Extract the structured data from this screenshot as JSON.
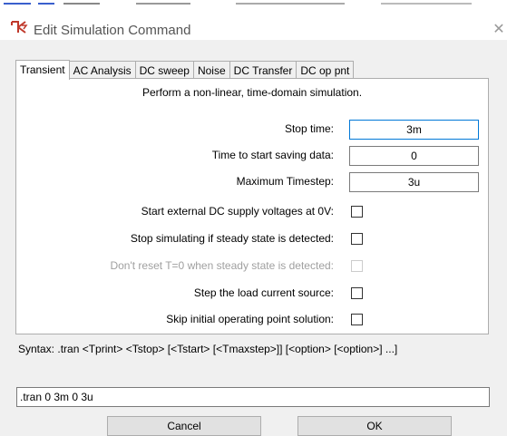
{
  "window": {
    "title": "Edit Simulation Command",
    "close_glyph": "✕"
  },
  "tabs": [
    "Transient",
    "AC Analysis",
    "DC sweep",
    "Noise",
    "DC Transfer",
    "DC op pnt"
  ],
  "transient": {
    "description": "Perform a non-linear, time-domain simulation.",
    "stop_time_label": "Stop time:",
    "stop_time_value": "3m",
    "start_saving_label": "Time to start saving data:",
    "start_saving_value": "0",
    "max_timestep_label": "Maximum Timestep:",
    "max_timestep_value": "3u",
    "checkboxes": [
      {
        "label": "Start external DC supply voltages at 0V:",
        "checked": false,
        "disabled": false
      },
      {
        "label": "Stop simulating if steady state is detected:",
        "checked": false,
        "disabled": false
      },
      {
        "label": "Don't reset T=0 when steady state is detected:",
        "checked": false,
        "disabled": true
      },
      {
        "label": "Step the load current source:",
        "checked": false,
        "disabled": false
      },
      {
        "label": "Skip initial operating point solution:",
        "checked": false,
        "disabled": false
      }
    ]
  },
  "syntax": "Syntax:  .tran <Tprint> <Tstop> [<Tstart> [<Tmaxstep>]] [<option> [<option>] ...]",
  "command_text": ".tran 0 3m 0 3u",
  "buttons": {
    "cancel": "Cancel",
    "ok": "OK"
  },
  "colors": {
    "focus_border": "#0078d7",
    "icon_red": "#c0392b"
  }
}
